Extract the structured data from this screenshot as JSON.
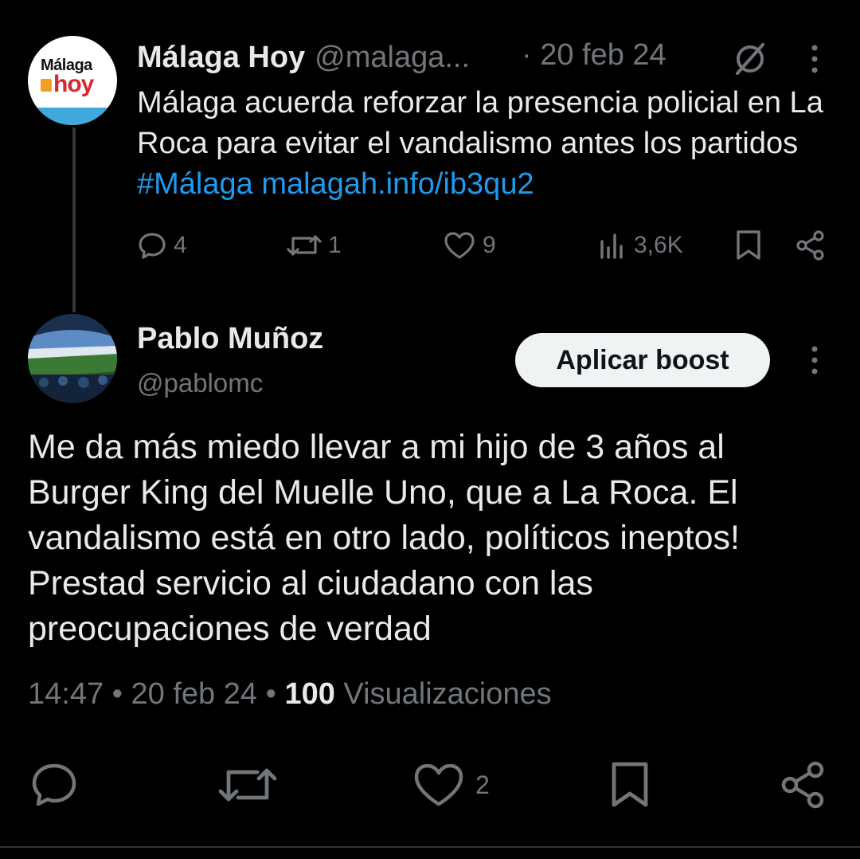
{
  "parent": {
    "avatar_text_1": "Málaga",
    "avatar_text_2": "hoy",
    "name": "Málaga Hoy",
    "handle": "@malaga...",
    "date": "· 20 feb 24",
    "text_plain": "Málaga acuerda reforzar la presencia policial en La Roca para evitar el vandalismo antes los partidos ",
    "hashtag": "#Málaga",
    "link": "malagah.info/ib3qu2",
    "icons": [
      "slash-circle-icon",
      "more-vertical-icon"
    ],
    "actions": {
      "replies": "4",
      "reposts": "1",
      "likes": "9",
      "views": "3,6K"
    },
    "colors": {
      "link": "#1d9bf0",
      "secondary": "#71767b"
    }
  },
  "main": {
    "name": "Pablo Muñoz",
    "handle": "@pablomc",
    "boost_label": "Aplicar boost",
    "text": "Me da más miedo llevar a mi hijo de 3 años al Burger King del Muelle Uno, que a La Roca. El vandalismo está en otro lado, políticos ineptos! Prestad servicio al ciudadano con las preocupaciones de verdad",
    "time": "14:47",
    "date": "20 feb 24",
    "views_count": "100",
    "views_label": "Visualizaciones",
    "separator": "•",
    "actions": {
      "likes": "2"
    }
  }
}
